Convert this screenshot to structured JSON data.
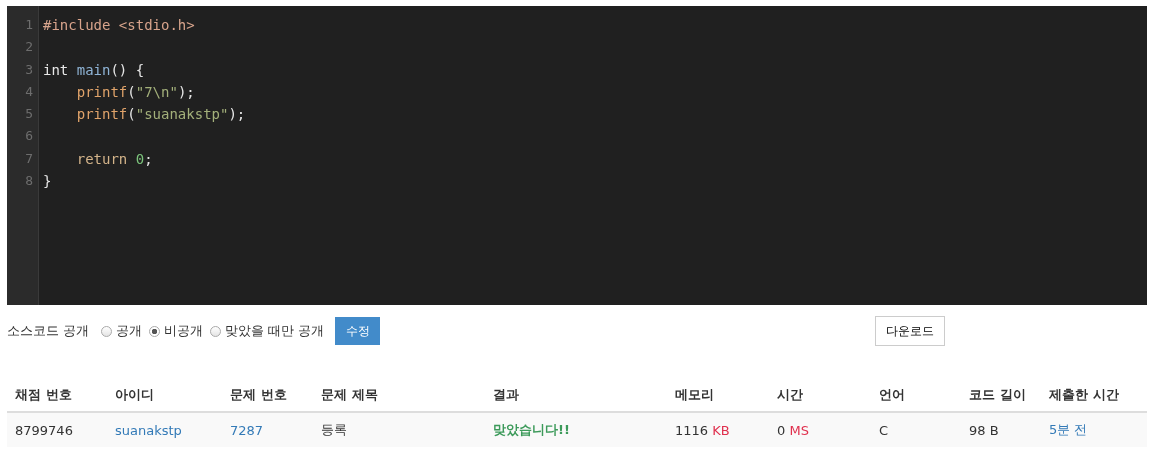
{
  "editor": {
    "lines": [
      {
        "number": "1",
        "indented": false,
        "tokens": [
          {
            "text": "#include <stdio.h>",
            "kind": "meta",
            "spaced": false
          }
        ]
      },
      {
        "number": "2",
        "indented": false
      },
      {
        "number": "3",
        "indented": false,
        "tokens": [
          {
            "text": "int",
            "kind": "type",
            "spaced": false
          },
          {
            "text": "main",
            "kind": "name",
            "spaced": true
          },
          {
            "text": "() {",
            "kind": "plain",
            "spaced": false
          }
        ]
      },
      {
        "number": "4",
        "indented": true,
        "tokens": [
          {
            "text": "printf",
            "kind": "call",
            "spaced": false
          },
          {
            "text": "(",
            "kind": "plain",
            "spaced": false
          },
          {
            "text": "\"7\\n\"",
            "kind": "string",
            "spaced": false
          },
          {
            "text": ");",
            "kind": "plain",
            "spaced": false
          }
        ]
      },
      {
        "number": "5",
        "indented": true,
        "tokens": [
          {
            "text": "printf",
            "kind": "call",
            "spaced": false
          },
          {
            "text": "(",
            "kind": "plain",
            "spaced": false
          },
          {
            "text": "\"suanakstp\"",
            "kind": "string",
            "spaced": false
          },
          {
            "text": ");",
            "kind": "plain",
            "spaced": false
          }
        ]
      },
      {
        "number": "6",
        "indented": false
      },
      {
        "number": "7",
        "indented": true,
        "tokens": [
          {
            "text": "return",
            "kind": "keyword",
            "spaced": false
          },
          {
            "text": "0",
            "kind": "number",
            "spaced": true
          },
          {
            "text": ";",
            "kind": "plain",
            "spaced": false
          }
        ]
      },
      {
        "number": "8",
        "indented": false,
        "tokens": [
          {
            "text": "}",
            "kind": "plain",
            "spaced": false
          }
        ]
      }
    ]
  },
  "visibility": {
    "label": "소스코드 공개",
    "options": [
      {
        "label": "공개",
        "selected": false
      },
      {
        "label": "비공개",
        "selected": true
      },
      {
        "label": "맞았을 때만 공개",
        "selected": false
      }
    ],
    "save_button": "수정",
    "download_button": "다운로드"
  },
  "table": {
    "columns": [
      "채점 번호",
      "아이디",
      "문제 번호",
      "문제 제목",
      "결과",
      "메모리",
      "시간",
      "언어",
      "코드 길이",
      "제출한 시간"
    ],
    "rows": [
      {
        "cells": [
          {
            "kind": "text",
            "text": "8799746"
          },
          {
            "kind": "link",
            "text": "suanakstp"
          },
          {
            "kind": "link",
            "text": "7287"
          },
          {
            "kind": "text",
            "text": "등록"
          },
          {
            "kind": "accepted",
            "text": "맞았습니다!!"
          },
          {
            "kind": "measure",
            "text": "1116",
            "unit": "KB"
          },
          {
            "kind": "measure",
            "text": "0",
            "unit": "MS"
          },
          {
            "kind": "text",
            "text": "C"
          },
          {
            "kind": "text",
            "text": "98 B"
          },
          {
            "kind": "link",
            "text": "5분 전"
          }
        ]
      }
    ]
  }
}
